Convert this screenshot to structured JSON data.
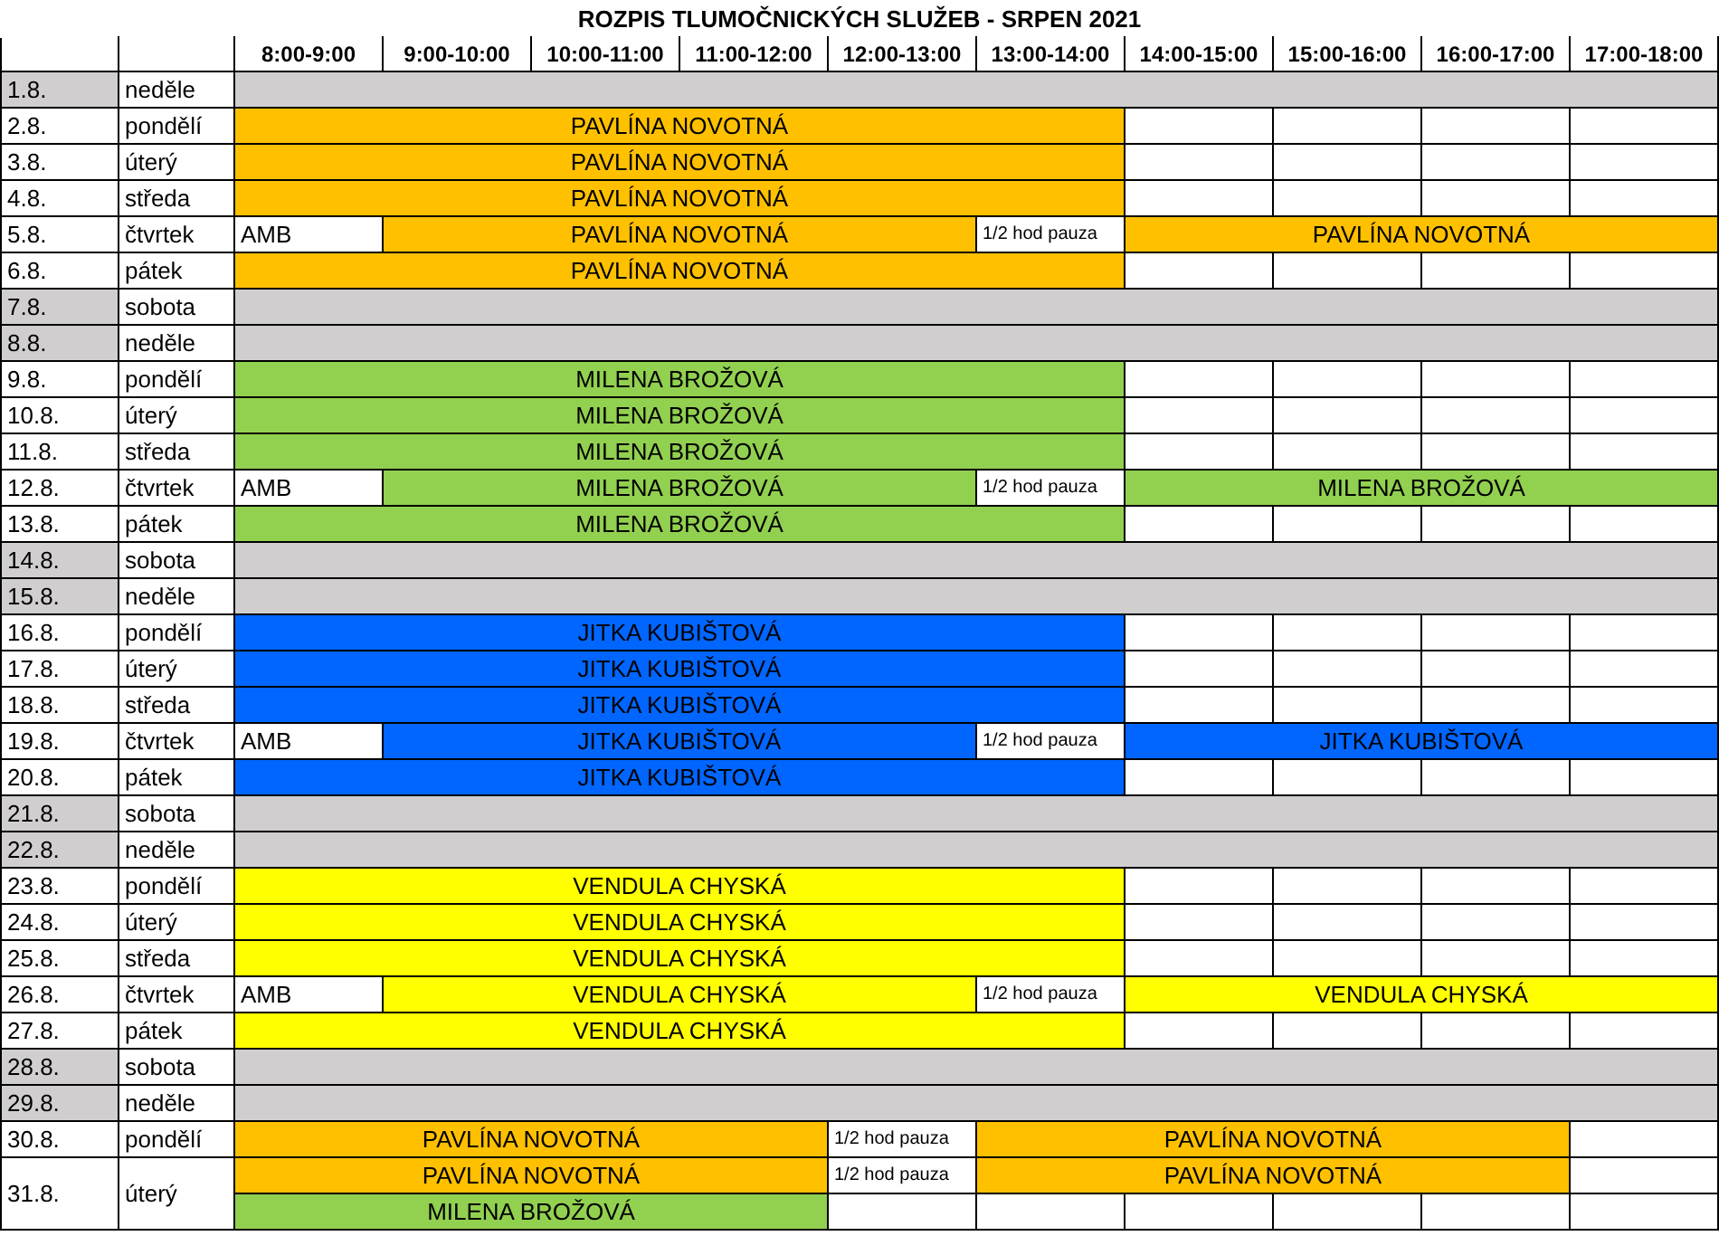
{
  "title": "ROZPIS TLUMOČNICKÝCH SLUŽEB - SRPEN 2021",
  "columns": [
    "8:00-9:00",
    "9:00-10:00",
    "10:00-11:00",
    "11:00-12:00",
    "12:00-13:00",
    "13:00-14:00",
    "14:00-15:00",
    "15:00-16:00",
    "16:00-17:00",
    "17:00-18:00"
  ],
  "days": [
    {
      "date": "1.8.",
      "day": "neděle",
      "weekend": true,
      "lines": [
        [
          {
            "kind": "off"
          },
          {
            "kind": "merged"
          },
          {
            "kind": "merged"
          },
          {
            "kind": "merged"
          },
          {
            "kind": "merged"
          },
          {
            "kind": "merged"
          },
          {
            "kind": "merged"
          },
          {
            "kind": "merged"
          },
          {
            "kind": "merged"
          },
          {
            "kind": "merged"
          }
        ]
      ]
    },
    {
      "date": "2.8.",
      "day": "pondělí",
      "weekend": false,
      "lines": [
        [
          {
            "kind": "name",
            "text": "PAVLÍNA NOVOTNÁ",
            "color": "#ffc000"
          },
          {
            "kind": "merged"
          },
          {
            "kind": "merged"
          },
          {
            "kind": "merged"
          },
          {
            "kind": "merged"
          },
          {
            "kind": "merged"
          },
          {
            "kind": "empty"
          },
          {
            "kind": "empty"
          },
          {
            "kind": "empty"
          },
          {
            "kind": "empty"
          }
        ]
      ]
    },
    {
      "date": "3.8.",
      "day": "úterý",
      "weekend": false,
      "lines": [
        [
          {
            "kind": "name",
            "text": "PAVLÍNA NOVOTNÁ",
            "color": "#ffc000"
          },
          {
            "kind": "merged"
          },
          {
            "kind": "merged"
          },
          {
            "kind": "merged"
          },
          {
            "kind": "merged"
          },
          {
            "kind": "merged"
          },
          {
            "kind": "empty"
          },
          {
            "kind": "empty"
          },
          {
            "kind": "empty"
          },
          {
            "kind": "empty"
          }
        ]
      ]
    },
    {
      "date": "4.8.",
      "day": "středa",
      "weekend": false,
      "lines": [
        [
          {
            "kind": "name",
            "text": "PAVLÍNA NOVOTNÁ",
            "color": "#ffc000"
          },
          {
            "kind": "merged"
          },
          {
            "kind": "merged"
          },
          {
            "kind": "merged"
          },
          {
            "kind": "merged"
          },
          {
            "kind": "merged"
          },
          {
            "kind": "empty"
          },
          {
            "kind": "empty"
          },
          {
            "kind": "empty"
          },
          {
            "kind": "empty"
          }
        ]
      ]
    },
    {
      "date": "5.8.",
      "day": "čtvrtek",
      "weekend": false,
      "lines": [
        [
          {
            "kind": "amb",
            "text": "AMB"
          },
          {
            "kind": "name",
            "text": "PAVLÍNA NOVOTNÁ",
            "color": "#ffc000"
          },
          {
            "kind": "merged"
          },
          {
            "kind": "merged"
          },
          {
            "kind": "merged"
          },
          {
            "kind": "note",
            "text": "1/2 hod pauza"
          },
          {
            "kind": "name",
            "text": "PAVLÍNA NOVOTNÁ",
            "color": "#ffc000"
          },
          {
            "kind": "merged"
          },
          {
            "kind": "merged"
          },
          {
            "kind": "merged"
          }
        ]
      ]
    },
    {
      "date": "6.8.",
      "day": "pátek",
      "weekend": false,
      "lines": [
        [
          {
            "kind": "name",
            "text": "PAVLÍNA NOVOTNÁ",
            "color": "#ffc000"
          },
          {
            "kind": "merged"
          },
          {
            "kind": "merged"
          },
          {
            "kind": "merged"
          },
          {
            "kind": "merged"
          },
          {
            "kind": "merged"
          },
          {
            "kind": "empty"
          },
          {
            "kind": "empty"
          },
          {
            "kind": "empty"
          },
          {
            "kind": "empty"
          }
        ]
      ]
    },
    {
      "date": "7.8.",
      "day": "sobota",
      "weekend": true,
      "lines": [
        [
          {
            "kind": "off"
          },
          {
            "kind": "merged"
          },
          {
            "kind": "merged"
          },
          {
            "kind": "merged"
          },
          {
            "kind": "merged"
          },
          {
            "kind": "merged"
          },
          {
            "kind": "merged"
          },
          {
            "kind": "merged"
          },
          {
            "kind": "merged"
          },
          {
            "kind": "merged"
          }
        ]
      ]
    },
    {
      "date": "8.8.",
      "day": "neděle",
      "weekend": true,
      "lines": [
        [
          {
            "kind": "off"
          },
          {
            "kind": "merged"
          },
          {
            "kind": "merged"
          },
          {
            "kind": "merged"
          },
          {
            "kind": "merged"
          },
          {
            "kind": "merged"
          },
          {
            "kind": "merged"
          },
          {
            "kind": "merged"
          },
          {
            "kind": "merged"
          },
          {
            "kind": "merged"
          }
        ]
      ]
    },
    {
      "date": "9.8.",
      "day": "pondělí",
      "weekend": false,
      "lines": [
        [
          {
            "kind": "name",
            "text": "MILENA BROŽOVÁ",
            "color": "#92d050"
          },
          {
            "kind": "merged"
          },
          {
            "kind": "merged"
          },
          {
            "kind": "merged"
          },
          {
            "kind": "merged"
          },
          {
            "kind": "merged"
          },
          {
            "kind": "empty"
          },
          {
            "kind": "empty"
          },
          {
            "kind": "empty"
          },
          {
            "kind": "empty"
          }
        ]
      ]
    },
    {
      "date": "10.8.",
      "day": "úterý",
      "weekend": false,
      "lines": [
        [
          {
            "kind": "name",
            "text": "MILENA BROŽOVÁ",
            "color": "#92d050"
          },
          {
            "kind": "merged"
          },
          {
            "kind": "merged"
          },
          {
            "kind": "merged"
          },
          {
            "kind": "merged"
          },
          {
            "kind": "merged"
          },
          {
            "kind": "empty"
          },
          {
            "kind": "empty"
          },
          {
            "kind": "empty"
          },
          {
            "kind": "empty"
          }
        ]
      ]
    },
    {
      "date": "11.8.",
      "day": "středa",
      "weekend": false,
      "lines": [
        [
          {
            "kind": "name",
            "text": "MILENA BROŽOVÁ",
            "color": "#92d050"
          },
          {
            "kind": "merged"
          },
          {
            "kind": "merged"
          },
          {
            "kind": "merged"
          },
          {
            "kind": "merged"
          },
          {
            "kind": "merged"
          },
          {
            "kind": "empty"
          },
          {
            "kind": "empty"
          },
          {
            "kind": "empty"
          },
          {
            "kind": "empty"
          }
        ]
      ]
    },
    {
      "date": "12.8.",
      "day": "čtvrtek",
      "weekend": false,
      "lines": [
        [
          {
            "kind": "amb",
            "text": "AMB"
          },
          {
            "kind": "name",
            "text": "MILENA BROŽOVÁ",
            "color": "#92d050"
          },
          {
            "kind": "merged"
          },
          {
            "kind": "merged"
          },
          {
            "kind": "merged"
          },
          {
            "kind": "note",
            "text": "1/2 hod pauza"
          },
          {
            "kind": "name",
            "text": "MILENA BROŽOVÁ",
            "color": "#92d050"
          },
          {
            "kind": "merged"
          },
          {
            "kind": "merged"
          },
          {
            "kind": "merged"
          }
        ]
      ]
    },
    {
      "date": "13.8.",
      "day": "pátek",
      "weekend": false,
      "lines": [
        [
          {
            "kind": "name",
            "text": "MILENA BROŽOVÁ",
            "color": "#92d050"
          },
          {
            "kind": "merged"
          },
          {
            "kind": "merged"
          },
          {
            "kind": "merged"
          },
          {
            "kind": "merged"
          },
          {
            "kind": "merged"
          },
          {
            "kind": "empty"
          },
          {
            "kind": "empty"
          },
          {
            "kind": "empty"
          },
          {
            "kind": "empty"
          }
        ]
      ]
    },
    {
      "date": "14.8.",
      "day": "sobota",
      "weekend": true,
      "lines": [
        [
          {
            "kind": "off"
          },
          {
            "kind": "merged"
          },
          {
            "kind": "merged"
          },
          {
            "kind": "merged"
          },
          {
            "kind": "merged"
          },
          {
            "kind": "merged"
          },
          {
            "kind": "merged"
          },
          {
            "kind": "merged"
          },
          {
            "kind": "merged"
          },
          {
            "kind": "merged"
          }
        ]
      ]
    },
    {
      "date": "15.8.",
      "day": "neděle",
      "weekend": true,
      "lines": [
        [
          {
            "kind": "off"
          },
          {
            "kind": "merged"
          },
          {
            "kind": "merged"
          },
          {
            "kind": "merged"
          },
          {
            "kind": "merged"
          },
          {
            "kind": "merged"
          },
          {
            "kind": "merged"
          },
          {
            "kind": "merged"
          },
          {
            "kind": "merged"
          },
          {
            "kind": "merged"
          }
        ]
      ]
    },
    {
      "date": "16.8.",
      "day": "pondělí",
      "weekend": false,
      "lines": [
        [
          {
            "kind": "name",
            "text": "JITKA KUBIŠTOVÁ",
            "color": "#0066ff"
          },
          {
            "kind": "merged"
          },
          {
            "kind": "merged"
          },
          {
            "kind": "merged"
          },
          {
            "kind": "merged"
          },
          {
            "kind": "merged"
          },
          {
            "kind": "empty"
          },
          {
            "kind": "empty"
          },
          {
            "kind": "empty"
          },
          {
            "kind": "empty"
          }
        ]
      ]
    },
    {
      "date": "17.8.",
      "day": "úterý",
      "weekend": false,
      "lines": [
        [
          {
            "kind": "name",
            "text": "JITKA KUBIŠTOVÁ",
            "color": "#0066ff"
          },
          {
            "kind": "merged"
          },
          {
            "kind": "merged"
          },
          {
            "kind": "merged"
          },
          {
            "kind": "merged"
          },
          {
            "kind": "merged"
          },
          {
            "kind": "empty"
          },
          {
            "kind": "empty"
          },
          {
            "kind": "empty"
          },
          {
            "kind": "empty"
          }
        ]
      ]
    },
    {
      "date": "18.8.",
      "day": "středa",
      "weekend": false,
      "lines": [
        [
          {
            "kind": "name",
            "text": "JITKA KUBIŠTOVÁ",
            "color": "#0066ff"
          },
          {
            "kind": "merged"
          },
          {
            "kind": "merged"
          },
          {
            "kind": "merged"
          },
          {
            "kind": "merged"
          },
          {
            "kind": "merged"
          },
          {
            "kind": "empty"
          },
          {
            "kind": "empty"
          },
          {
            "kind": "empty"
          },
          {
            "kind": "empty"
          }
        ]
      ]
    },
    {
      "date": "19.8.",
      "day": "čtvrtek",
      "weekend": false,
      "lines": [
        [
          {
            "kind": "amb",
            "text": "AMB"
          },
          {
            "kind": "name",
            "text": "JITKA KUBIŠTOVÁ",
            "color": "#0066ff"
          },
          {
            "kind": "merged"
          },
          {
            "kind": "merged"
          },
          {
            "kind": "merged"
          },
          {
            "kind": "note",
            "text": "1/2 hod pauza"
          },
          {
            "kind": "name",
            "text": "JITKA KUBIŠTOVÁ",
            "color": "#0066ff"
          },
          {
            "kind": "merged"
          },
          {
            "kind": "merged"
          },
          {
            "kind": "merged"
          }
        ]
      ]
    },
    {
      "date": "20.8.",
      "day": "pátek",
      "weekend": false,
      "lines": [
        [
          {
            "kind": "name",
            "text": "JITKA KUBIŠTOVÁ",
            "color": "#0066ff"
          },
          {
            "kind": "merged"
          },
          {
            "kind": "merged"
          },
          {
            "kind": "merged"
          },
          {
            "kind": "merged"
          },
          {
            "kind": "merged"
          },
          {
            "kind": "empty"
          },
          {
            "kind": "empty"
          },
          {
            "kind": "empty"
          },
          {
            "kind": "empty"
          }
        ]
      ]
    },
    {
      "date": "21.8.",
      "day": "sobota",
      "weekend": true,
      "lines": [
        [
          {
            "kind": "off"
          },
          {
            "kind": "merged"
          },
          {
            "kind": "merged"
          },
          {
            "kind": "merged"
          },
          {
            "kind": "merged"
          },
          {
            "kind": "merged"
          },
          {
            "kind": "merged"
          },
          {
            "kind": "merged"
          },
          {
            "kind": "merged"
          },
          {
            "kind": "merged"
          }
        ]
      ]
    },
    {
      "date": "22.8.",
      "day": "neděle",
      "weekend": true,
      "lines": [
        [
          {
            "kind": "off"
          },
          {
            "kind": "merged"
          },
          {
            "kind": "merged"
          },
          {
            "kind": "merged"
          },
          {
            "kind": "merged"
          },
          {
            "kind": "merged"
          },
          {
            "kind": "merged"
          },
          {
            "kind": "merged"
          },
          {
            "kind": "merged"
          },
          {
            "kind": "merged"
          }
        ]
      ]
    },
    {
      "date": "23.8.",
      "day": "pondělí",
      "weekend": false,
      "lines": [
        [
          {
            "kind": "name",
            "text": "VENDULA CHYSKÁ",
            "color": "#ffff00"
          },
          {
            "kind": "merged"
          },
          {
            "kind": "merged"
          },
          {
            "kind": "merged"
          },
          {
            "kind": "merged"
          },
          {
            "kind": "merged"
          },
          {
            "kind": "empty"
          },
          {
            "kind": "empty"
          },
          {
            "kind": "empty"
          },
          {
            "kind": "empty"
          }
        ]
      ]
    },
    {
      "date": "24.8.",
      "day": "úterý",
      "weekend": false,
      "lines": [
        [
          {
            "kind": "name",
            "text": "VENDULA CHYSKÁ",
            "color": "#ffff00"
          },
          {
            "kind": "merged"
          },
          {
            "kind": "merged"
          },
          {
            "kind": "merged"
          },
          {
            "kind": "merged"
          },
          {
            "kind": "merged"
          },
          {
            "kind": "empty"
          },
          {
            "kind": "empty"
          },
          {
            "kind": "empty"
          },
          {
            "kind": "empty"
          }
        ]
      ]
    },
    {
      "date": "25.8.",
      "day": "středa",
      "weekend": false,
      "lines": [
        [
          {
            "kind": "name",
            "text": "VENDULA CHYSKÁ",
            "color": "#ffff00"
          },
          {
            "kind": "merged"
          },
          {
            "kind": "merged"
          },
          {
            "kind": "merged"
          },
          {
            "kind": "merged"
          },
          {
            "kind": "merged"
          },
          {
            "kind": "empty"
          },
          {
            "kind": "empty"
          },
          {
            "kind": "empty"
          },
          {
            "kind": "empty"
          }
        ]
      ]
    },
    {
      "date": "26.8.",
      "day": "čtvrtek",
      "weekend": false,
      "lines": [
        [
          {
            "kind": "amb",
            "text": "AMB"
          },
          {
            "kind": "name",
            "text": "VENDULA CHYSKÁ",
            "color": "#ffff00"
          },
          {
            "kind": "merged"
          },
          {
            "kind": "merged"
          },
          {
            "kind": "merged"
          },
          {
            "kind": "note",
            "text": "1/2 hod pauza"
          },
          {
            "kind": "name",
            "text": "VENDULA CHYSKÁ",
            "color": "#ffff00"
          },
          {
            "kind": "merged"
          },
          {
            "kind": "merged"
          },
          {
            "kind": "merged"
          }
        ]
      ]
    },
    {
      "date": "27.8.",
      "day": "pátek",
      "weekend": false,
      "lines": [
        [
          {
            "kind": "name",
            "text": "VENDULA CHYSKÁ",
            "color": "#ffff00"
          },
          {
            "kind": "merged"
          },
          {
            "kind": "merged"
          },
          {
            "kind": "merged"
          },
          {
            "kind": "merged"
          },
          {
            "kind": "merged"
          },
          {
            "kind": "empty"
          },
          {
            "kind": "empty"
          },
          {
            "kind": "empty"
          },
          {
            "kind": "empty"
          }
        ]
      ]
    },
    {
      "date": "28.8.",
      "day": "sobota",
      "weekend": true,
      "lines": [
        [
          {
            "kind": "off"
          },
          {
            "kind": "merged"
          },
          {
            "kind": "merged"
          },
          {
            "kind": "merged"
          },
          {
            "kind": "merged"
          },
          {
            "kind": "merged"
          },
          {
            "kind": "merged"
          },
          {
            "kind": "merged"
          },
          {
            "kind": "merged"
          },
          {
            "kind": "merged"
          }
        ]
      ]
    },
    {
      "date": "29.8.",
      "day": "neděle",
      "weekend": true,
      "lines": [
        [
          {
            "kind": "off"
          },
          {
            "kind": "merged"
          },
          {
            "kind": "merged"
          },
          {
            "kind": "merged"
          },
          {
            "kind": "merged"
          },
          {
            "kind": "merged"
          },
          {
            "kind": "merged"
          },
          {
            "kind": "merged"
          },
          {
            "kind": "merged"
          },
          {
            "kind": "merged"
          }
        ]
      ]
    },
    {
      "date": "30.8.",
      "day": "pondělí",
      "weekend": false,
      "lines": [
        [
          {
            "kind": "name",
            "text": "PAVLÍNA NOVOTNÁ",
            "color": "#ffc000"
          },
          {
            "kind": "merged"
          },
          {
            "kind": "merged"
          },
          {
            "kind": "merged"
          },
          {
            "kind": "note",
            "text": "1/2 hod pauza"
          },
          {
            "kind": "name",
            "text": "PAVLÍNA NOVOTNÁ",
            "color": "#ffc000"
          },
          {
            "kind": "merged"
          },
          {
            "kind": "merged"
          },
          {
            "kind": "merged"
          },
          {
            "kind": "empty"
          }
        ]
      ]
    },
    {
      "date": "31.8.",
      "day": "úterý",
      "weekend": false,
      "lines": [
        [
          {
            "kind": "name",
            "text": "PAVLÍNA NOVOTNÁ",
            "color": "#ffc000"
          },
          {
            "kind": "merged"
          },
          {
            "kind": "merged"
          },
          {
            "kind": "merged"
          },
          {
            "kind": "note",
            "text": "1/2 hod pauza"
          },
          {
            "kind": "name",
            "text": "PAVLÍNA NOVOTNÁ",
            "color": "#ffc000"
          },
          {
            "kind": "merged"
          },
          {
            "kind": "merged"
          },
          {
            "kind": "merged"
          },
          {
            "kind": "empty"
          }
        ],
        [
          {
            "kind": "name",
            "text": "MILENA BROŽOVÁ",
            "color": "#92d050"
          },
          {
            "kind": "merged"
          },
          {
            "kind": "merged"
          },
          {
            "kind": "merged"
          },
          {
            "kind": "empty"
          },
          {
            "kind": "empty"
          },
          {
            "kind": "empty"
          },
          {
            "kind": "empty"
          },
          {
            "kind": "empty"
          },
          {
            "kind": "empty"
          }
        ]
      ]
    }
  ]
}
